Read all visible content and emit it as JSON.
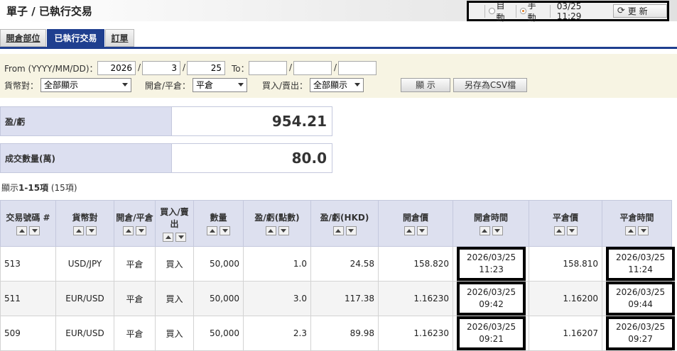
{
  "header": {
    "title": "單子 / 已執行交易",
    "mode_auto": "自動",
    "mode_manual": "手 動",
    "timestamp": "03/25 11:29",
    "refresh_label": "更 新"
  },
  "tabs": [
    {
      "label": "開倉部位",
      "active": false
    },
    {
      "label": "已執行交易",
      "active": true
    },
    {
      "label": "訂單",
      "active": false
    }
  ],
  "filters": {
    "from_label": "From (YYYY/MM/DD)：",
    "from_year": "2026",
    "from_month": "3",
    "from_day": "25",
    "slash": "/",
    "to_label": "To：",
    "to_year": "",
    "to_month": "",
    "to_day": "",
    "currency_label": "貨幣對：",
    "currency_value": "全部顯示",
    "open_close_label": "開倉/平倉：",
    "open_close_value": "平倉",
    "buy_sell_label": "買入/賣出：",
    "buy_sell_value": "全部顯示",
    "display_button": "顯 示",
    "csv_button": "另存為CSV檔"
  },
  "summary": {
    "pnl_label": "盈/虧",
    "pnl_value": "954.21",
    "volume_label": "成交數量(萬)",
    "volume_value": "80.0"
  },
  "count": {
    "prefix": "顯示",
    "range": "1-15項",
    "total": " (15項)"
  },
  "table": {
    "columns": [
      {
        "label": "交易號碼 #"
      },
      {
        "label": "貨幣對"
      },
      {
        "label": "開倉/平倉"
      },
      {
        "label": "買入/賣出"
      },
      {
        "label": "數量"
      },
      {
        "label": "盈/虧(點數)"
      },
      {
        "label": "盈/虧(HKD)"
      },
      {
        "label": "開倉價"
      },
      {
        "label": "開倉時間"
      },
      {
        "label": "平倉價"
      },
      {
        "label": "平倉時間"
      }
    ],
    "rows": [
      {
        "id": "513",
        "pair": "USD/JPY",
        "open_close": "平倉",
        "side": "買入",
        "qty": "50,000",
        "pips": "1.0",
        "pnl": "24.58",
        "open_price": "158.820",
        "open_date": "2026/03/25",
        "open_time": "11:23",
        "close_price": "158.810",
        "close_date": "2026/03/25",
        "close_time": "11:24"
      },
      {
        "id": "511",
        "pair": "EUR/USD",
        "open_close": "平倉",
        "side": "買入",
        "qty": "50,000",
        "pips": "3.0",
        "pnl": "117.38",
        "open_price": "1.16230",
        "open_date": "2026/03/25",
        "open_time": "09:42",
        "close_price": "1.16200",
        "close_date": "2026/03/25",
        "close_time": "09:44"
      },
      {
        "id": "509",
        "pair": "EUR/USD",
        "open_close": "平倉",
        "side": "買入",
        "qty": "50,000",
        "pips": "2.3",
        "pnl": "89.98",
        "open_price": "1.16230",
        "open_date": "2026/03/25",
        "open_time": "09:21",
        "close_price": "1.16207",
        "close_date": "2026/03/25",
        "close_time": "09:27"
      }
    ]
  }
}
